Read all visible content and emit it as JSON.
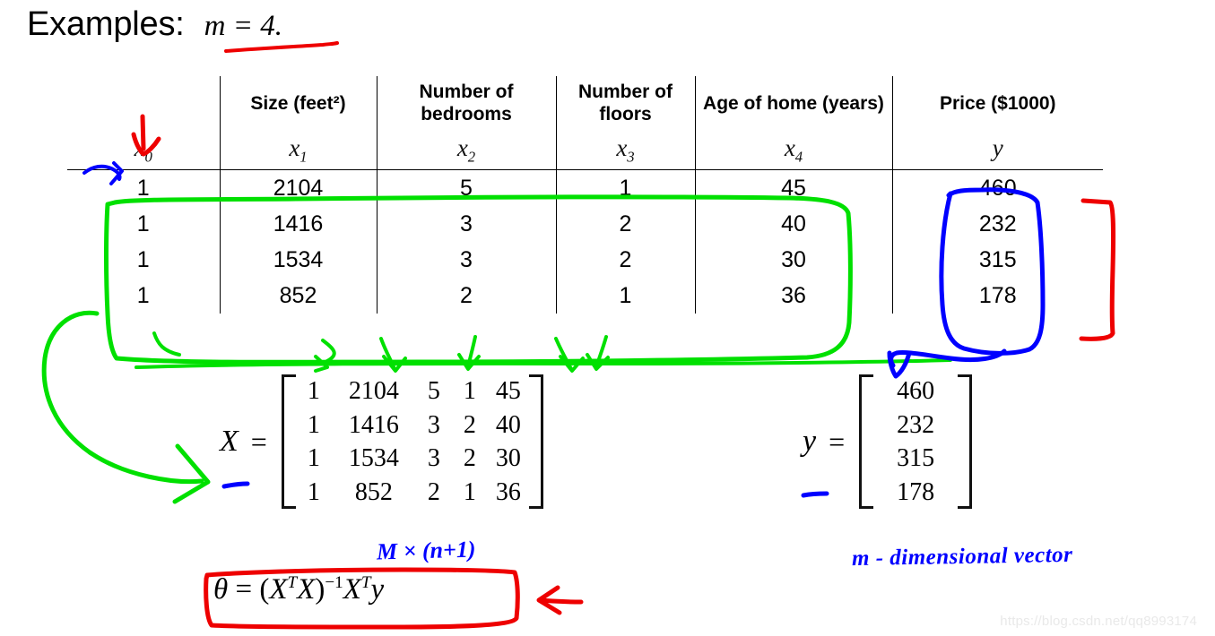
{
  "slide": {
    "title_label": "Examples:",
    "title_math": "m = 4.",
    "watermark": "https://blog.csdn.net/qq8993174"
  },
  "colors": {
    "red": "#ee0000",
    "green": "#00e000",
    "blue": "#0000ff",
    "ink_black": "#111111",
    "watermark": "#e9e9e9"
  },
  "table": {
    "headers": [
      "",
      "Size (feet²)",
      "Number of bedrooms",
      "Number of floors",
      "Age of home (years)",
      "Price ($1000)"
    ],
    "symbols": [
      "x₀",
      "x₁",
      "x₂",
      "x₃",
      "x₄",
      "y"
    ],
    "symbol_bases": [
      "x",
      "x",
      "x",
      "x",
      "x",
      "y"
    ],
    "symbol_subs": [
      "0",
      "1",
      "2",
      "3",
      "4",
      ""
    ],
    "rows": [
      [
        "1",
        "2104",
        "5",
        "1",
        "45",
        "460"
      ],
      [
        "1",
        "1416",
        "3",
        "2",
        "40",
        "232"
      ],
      [
        "1",
        "1534",
        "3",
        "2",
        "30",
        "315"
      ],
      [
        "1",
        "852",
        "2",
        "1",
        "36",
        "178"
      ]
    ]
  },
  "matrices": {
    "X": {
      "label": "X",
      "equals": "=",
      "rows": [
        [
          "1",
          "2104",
          "5",
          "1",
          "45"
        ],
        [
          "1",
          "1416",
          "3",
          "2",
          "40"
        ],
        [
          "1",
          "1534",
          "3",
          "2",
          "30"
        ],
        [
          "1",
          "852",
          "2",
          "1",
          "36"
        ]
      ],
      "dimension_note": "M × (n+1)"
    },
    "y": {
      "label": "y",
      "equals": "=",
      "rows": [
        [
          "460"
        ],
        [
          "232"
        ],
        [
          "315"
        ],
        [
          "178"
        ]
      ],
      "dimension_note": "m - dimensional    vector"
    }
  },
  "formula": {
    "theta": "θ",
    "equals": "=",
    "expression": "(XᵀX)⁻¹Xᵀy",
    "parts": {
      "open_paren": "(",
      "X1": "X",
      "T1": "T",
      "X2": "X",
      "close_paren": ")",
      "inv": "−1",
      "X3": "X",
      "T2": "T",
      "y": "y"
    }
  },
  "annotations": [
    {
      "name": "red-down-arrow-x0",
      "color": "#ee0000",
      "target": "x₀"
    },
    {
      "name": "blue-right-arrow-x0",
      "color": "#0000ff",
      "target": "x₀"
    },
    {
      "name": "red-underline-title",
      "color": "#ee0000",
      "target": "m = 4."
    },
    {
      "name": "green-lasso-feature-block",
      "color": "#00e000",
      "target": "feature columns"
    },
    {
      "name": "green-arrow-to-X",
      "color": "#00e000",
      "target": "X ="
    },
    {
      "name": "green-column-arrows",
      "color": "#00e000",
      "target": "matrix columns"
    },
    {
      "name": "blue-lasso-price-column",
      "color": "#0000ff",
      "target": "Price ($1000)"
    },
    {
      "name": "blue-arrow-to-y",
      "color": "#0000ff",
      "target": "y ="
    },
    {
      "name": "red-bracket-rows",
      "color": "#ee0000",
      "target": "data rows"
    },
    {
      "name": "red-box-normal-equation",
      "color": "#ee0000",
      "target": "θ = (XᵀX)⁻¹Xᵀy"
    },
    {
      "name": "red-arrow-to-equation",
      "color": "#ee0000",
      "target": "normal equation"
    },
    {
      "name": "blue-underline-X",
      "color": "#0000ff",
      "target": "X"
    },
    {
      "name": "blue-underline-y",
      "color": "#0000ff",
      "target": "y"
    }
  ]
}
